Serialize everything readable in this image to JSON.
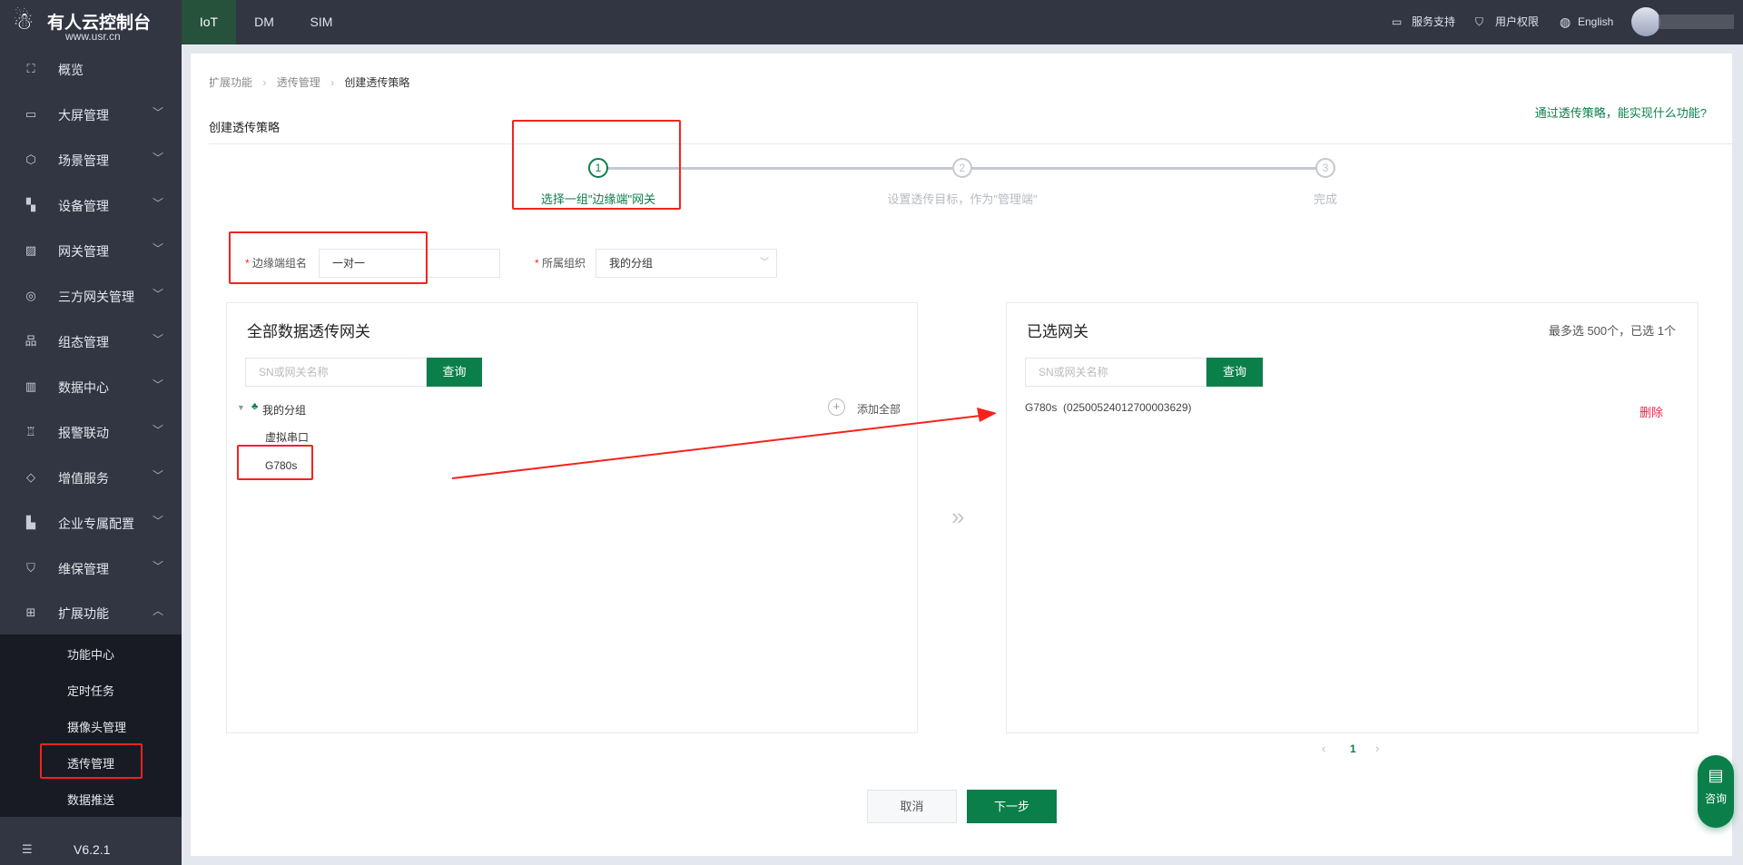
{
  "brand": {
    "name": "有人云控制台",
    "url": "www.usr.cn"
  },
  "top_tabs": [
    {
      "label": "IoT",
      "active": true
    },
    {
      "label": "DM"
    },
    {
      "label": "SIM"
    }
  ],
  "top_right": {
    "support": "服务支持",
    "permissions": "用户权限",
    "language": "English"
  },
  "sidebar": {
    "items": [
      {
        "label": "概览",
        "icon": "scan-icon"
      },
      {
        "label": "大屏管理",
        "icon": "monitor-icon"
      },
      {
        "label": "场景管理",
        "icon": "cube-icon"
      },
      {
        "label": "设备管理",
        "icon": "device-icon"
      },
      {
        "label": "网关管理",
        "icon": "chart-icon"
      },
      {
        "label": "三方网关管理",
        "icon": "cluster-icon"
      },
      {
        "label": "组态管理",
        "icon": "topology-icon"
      },
      {
        "label": "数据中心",
        "icon": "bar-chart-icon"
      },
      {
        "label": "报警联动",
        "icon": "alarm-icon"
      },
      {
        "label": "增值服务",
        "icon": "diamond-icon"
      },
      {
        "label": "企业专属配置",
        "icon": "building-icon"
      },
      {
        "label": "维保管理",
        "icon": "shield-check-icon"
      },
      {
        "label": "扩展功能",
        "icon": "grid-icon",
        "expanded": true
      }
    ],
    "sub_items": [
      "功能中心",
      "定时任务",
      "摄像头管理",
      "透传管理",
      "数据推送"
    ],
    "active_sub": "透传管理",
    "version": "V6.2.1"
  },
  "breadcrumb": [
    "扩展功能",
    "透传管理",
    "创建透传策略"
  ],
  "page_title": "创建透传策略",
  "help_link": "通过透传策略，能实现什么功能?",
  "steps": [
    {
      "num": "1",
      "label": "选择一组\"边缘端\"网关",
      "active": true
    },
    {
      "num": "2",
      "label": "设置透传目标，作为\"管理端\""
    },
    {
      "num": "3",
      "label": "完成"
    }
  ],
  "form": {
    "group_name_label": "边缘端组名",
    "group_name_value": "一对一",
    "org_label": "所属组织",
    "org_value": "我的分组",
    "required_mark": "*"
  },
  "left_panel": {
    "title": "全部数据透传网关",
    "search_placeholder": "SN或网关名称",
    "search_button": "查询",
    "tree_root": "我的分组",
    "add_all": "添加全部",
    "children": [
      "虚拟串口",
      "G780s"
    ]
  },
  "right_panel": {
    "title": "已选网关",
    "count_text": "最多选 500个，已选 1个",
    "search_placeholder": "SN或网关名称",
    "search_button": "查询",
    "selected": [
      {
        "name": "G780s",
        "sn": "(02500524012700003629)",
        "action": "删除"
      }
    ]
  },
  "pagination": {
    "current": "1"
  },
  "footer": {
    "cancel": "取消",
    "next": "下一步"
  },
  "consult": "咨询",
  "colors": {
    "accent": "#0b7f4a",
    "danger": "#e6294f",
    "annotation": "#f5221c"
  }
}
